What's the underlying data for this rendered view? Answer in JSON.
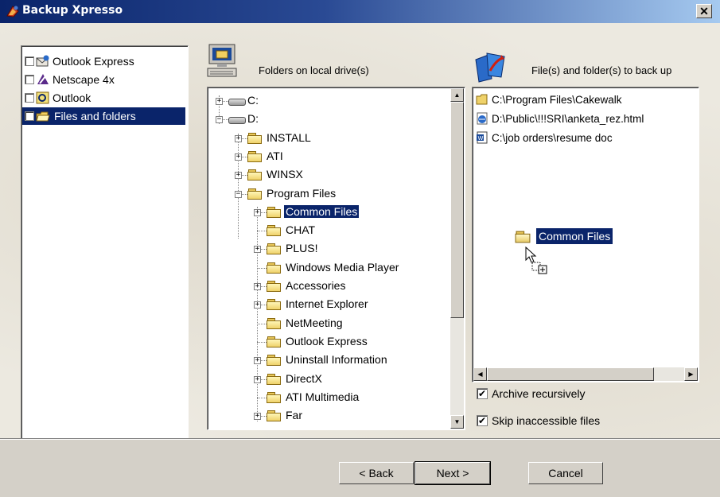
{
  "window": {
    "title": "Backup Xpresso",
    "close_label": "✕"
  },
  "sources": [
    {
      "label": "Outlook Express",
      "checked": false,
      "icon": "outlook-express-icon"
    },
    {
      "label": "Netscape 4x",
      "checked": false,
      "icon": "netscape-icon"
    },
    {
      "label": "Outlook",
      "checked": false,
      "icon": "outlook-icon"
    },
    {
      "label": "Files and folders",
      "checked": true,
      "icon": "files-folders-icon",
      "selected": true
    }
  ],
  "local_drives": {
    "header": "Folders on local drive(s)",
    "tree": [
      {
        "label": "C:",
        "type": "drive",
        "expander": "+"
      },
      {
        "label": "D:",
        "type": "drive",
        "expander": "-"
      },
      {
        "label": "INSTALL",
        "type": "folder",
        "expander": "+"
      },
      {
        "label": "ATI",
        "type": "folder",
        "expander": "+"
      },
      {
        "label": "WINSX",
        "type": "folder",
        "expander": "+"
      },
      {
        "label": "Program Files",
        "type": "folder",
        "expander": "-"
      },
      {
        "label": "Common Files",
        "type": "folder-open",
        "expander": "+",
        "selected": true
      },
      {
        "label": "CHAT",
        "type": "folder",
        "expander": ""
      },
      {
        "label": "PLUS!",
        "type": "folder",
        "expander": "+"
      },
      {
        "label": "Windows Media Player",
        "type": "folder",
        "expander": ""
      },
      {
        "label": "Accessories",
        "type": "folder",
        "expander": "+"
      },
      {
        "label": "Internet Explorer",
        "type": "folder",
        "expander": "+"
      },
      {
        "label": "NetMeeting",
        "type": "folder",
        "expander": ""
      },
      {
        "label": "Outlook Express",
        "type": "folder",
        "expander": ""
      },
      {
        "label": "Uninstall Information",
        "type": "folder",
        "expander": "+"
      },
      {
        "label": "DirectX",
        "type": "folder",
        "expander": "+"
      },
      {
        "label": "ATI Multimedia",
        "type": "folder",
        "expander": ""
      },
      {
        "label": "Far",
        "type": "folder",
        "expander": "+"
      }
    ]
  },
  "backup_list": {
    "header": "File(s) and folder(s) to back up",
    "items": [
      {
        "label": "C:\\Program Files\\Cakewalk",
        "icon": "folder-icon"
      },
      {
        "label": "D:\\Public\\!!!SRI\\anketa_rez.html",
        "icon": "html-file-icon"
      },
      {
        "label": "C:\\job orders\\resume doc",
        "icon": "word-doc-icon"
      }
    ],
    "drag_label": "Common Files"
  },
  "options": {
    "archive_recursively": {
      "label": "Archive recursively",
      "checked": true
    },
    "skip_inaccessible": {
      "label": "Skip inaccessible files",
      "checked": true
    }
  },
  "buttons": {
    "back": "< Back",
    "next": "Next >",
    "cancel": "Cancel"
  }
}
